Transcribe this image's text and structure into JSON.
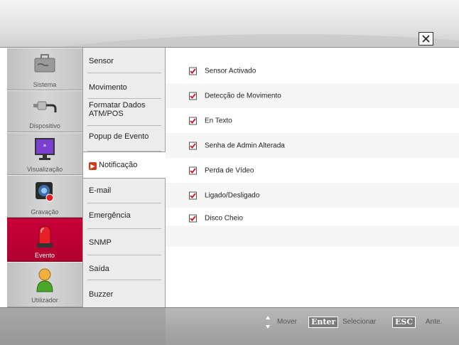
{
  "categories": [
    {
      "key": "sistema",
      "label": "Sistema"
    },
    {
      "key": "dispositivo",
      "label": "Dispositivo"
    },
    {
      "key": "visualizacao",
      "label": "Visualização"
    },
    {
      "key": "gravacao",
      "label": "Gravação"
    },
    {
      "key": "evento",
      "label": "Evento",
      "active": true
    },
    {
      "key": "utilizador",
      "label": "Utilizador"
    }
  ],
  "submenu": [
    {
      "label": "Sensor"
    },
    {
      "label": "Movimento"
    },
    {
      "label": "Formatar Dados\nATM/POS"
    },
    {
      "label": "Popup de Evento"
    },
    {
      "label": "Notificação",
      "active": true
    },
    {
      "label": "E-mail"
    },
    {
      "label": "Emergência"
    },
    {
      "label": "SNMP"
    },
    {
      "label": "Saída"
    },
    {
      "label": "Buzzer"
    }
  ],
  "options": [
    {
      "label": "Sensor Activado",
      "checked": true
    },
    {
      "label": "Detecção de Movimento",
      "checked": true
    },
    {
      "label": "En Texto",
      "checked": true
    },
    {
      "label": "Senha de Admin Alterada",
      "checked": true
    },
    {
      "label": "Perda de Vídeo",
      "checked": true
    },
    {
      "label": "Ligado/Desligado",
      "checked": true
    },
    {
      "label": "Disco Cheio",
      "checked": true
    }
  ],
  "footer": {
    "move_label": "Mover",
    "enter_key": "Enter",
    "select_label": "Selecionar",
    "esc_key": "ESC",
    "back_label": "Ante."
  },
  "colors": {
    "accent": "#c4003a",
    "check": "#c8102e"
  }
}
